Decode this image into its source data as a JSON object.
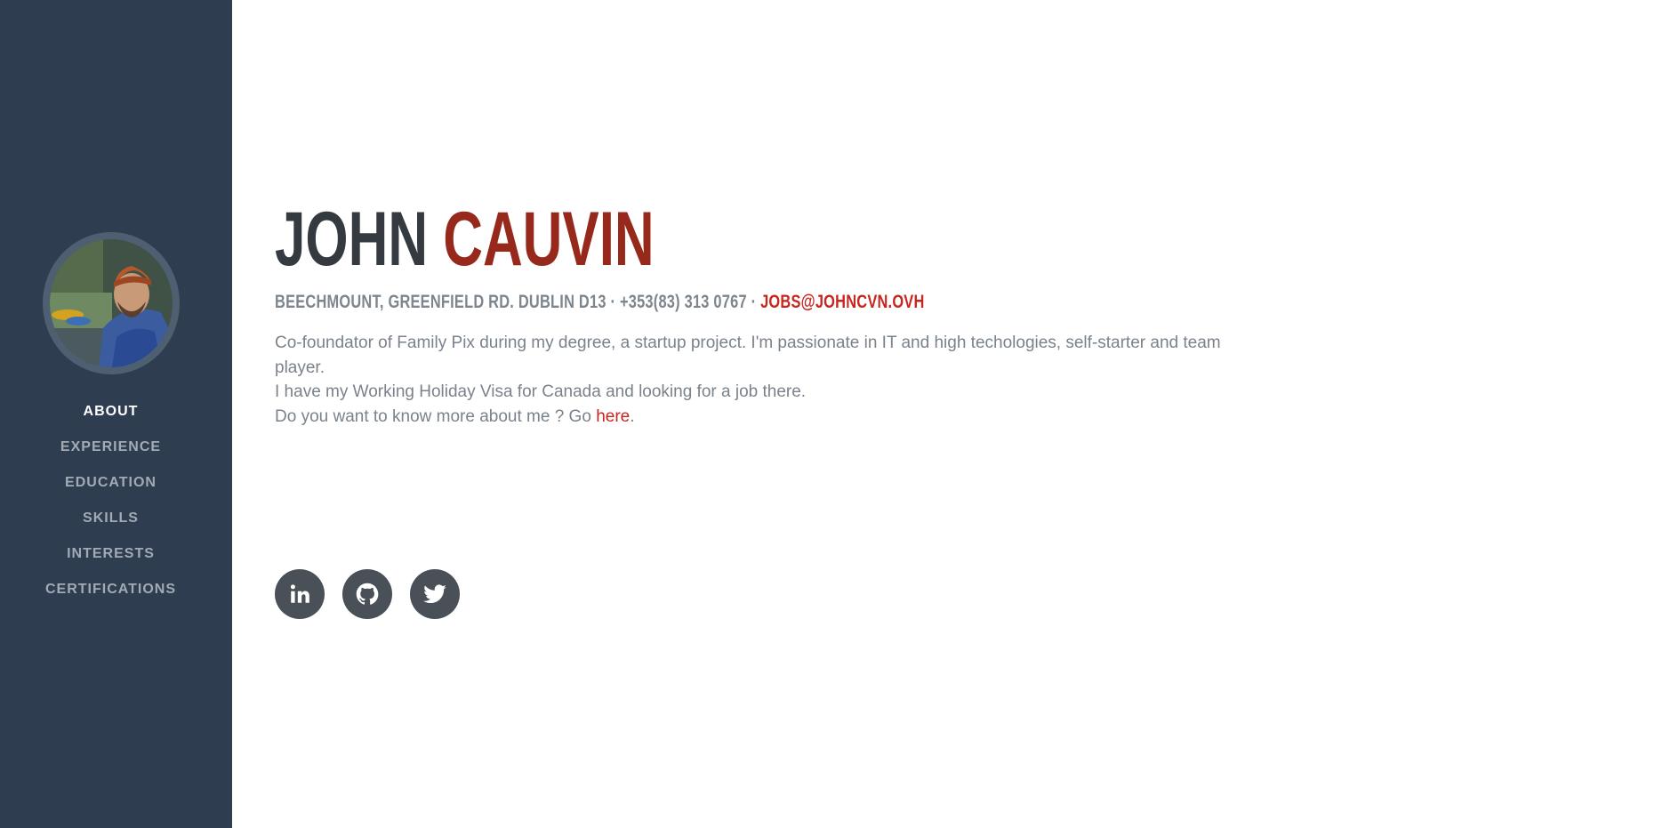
{
  "profile": {
    "first_name": "JOHN",
    "last_name": "CAUVIN",
    "address": "BEECHMOUNT, GREENFIELD RD. DUBLIN D13 · +353(83) 313 0767 · ",
    "email": "JOBS@JOHNCVN.OVH"
  },
  "bio": {
    "line1": "Co-foundator of Family Pix during my degree, a startup project. I'm passionate in IT and high techologies, self-starter and team player.",
    "line2": "I have my Working Holiday Visa for Canada and looking for a job there.",
    "line3_prefix": "Do you want to know more about me ? Go ",
    "line3_link": "here",
    "line3_suffix": "."
  },
  "nav": {
    "items": [
      {
        "label": "ABOUT",
        "active": true
      },
      {
        "label": "EXPERIENCE"
      },
      {
        "label": "EDUCATION"
      },
      {
        "label": "SKILLS"
      },
      {
        "label": "INTERESTS"
      },
      {
        "label": "CERTIFICATIONS"
      }
    ]
  },
  "social": [
    "linkedin-icon",
    "github-icon",
    "twitter-icon"
  ],
  "colors": {
    "sidebar": "#2f3d50",
    "accent": "#97281c",
    "link": "#c7261f",
    "social_bg": "#495057"
  }
}
